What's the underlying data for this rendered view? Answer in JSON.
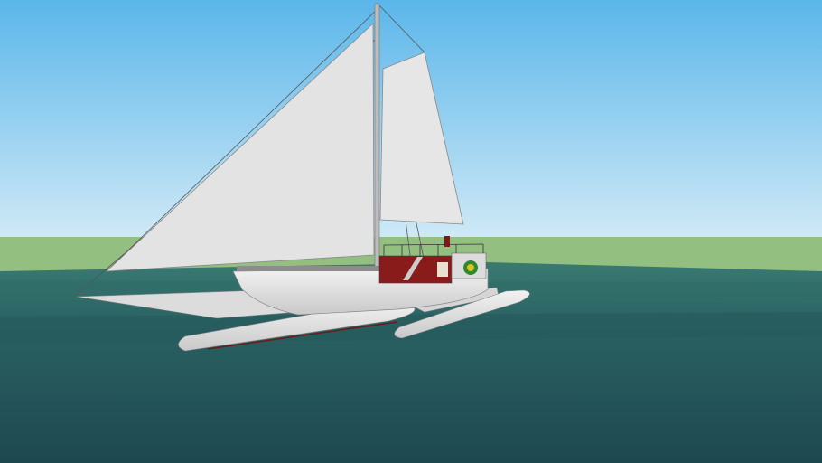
{
  "scene": {
    "subject": "trimaran-sailboat-3d-model",
    "colors": {
      "sky_top": "#5ab6ea",
      "sky_horizon": "#cfe9f6",
      "ground": "#93bf80",
      "sea_far": "#3a7a72",
      "sea_near": "#1e4850",
      "sail": "#e4e4e4",
      "hull": "#e8e8e8",
      "cabin": "#8a1b1b"
    }
  }
}
